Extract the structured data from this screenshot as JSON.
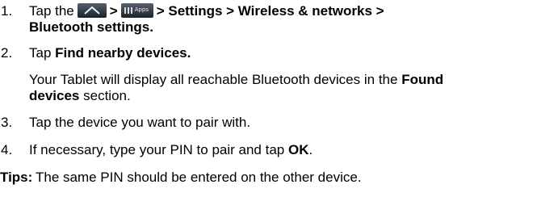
{
  "steps": [
    {
      "number": "1.",
      "text_tap": "Tap the",
      "sep1": ">",
      "path": "> Settings > Wireless & networks >",
      "path2": "Bluetooth settings."
    },
    {
      "number": "2.",
      "pre": "Tap",
      "bold": "Find nearby devices.",
      "note_pre": "Your Tablet will display all reachable Bluetooth devices in the",
      "note_bold1": "Found",
      "note_bold2": "devices",
      "note_post": "section."
    },
    {
      "number": "3.",
      "text": "Tap the device you want to pair with."
    },
    {
      "number": "4.",
      "pre": "If necessary, type your PIN to pair and tap",
      "bold": "OK",
      "post": "."
    }
  ],
  "tips": {
    "label": "Tips:",
    "text": "The same PIN should be entered on the other device."
  },
  "icons": {
    "home": "home-icon",
    "apps": "apps-icon",
    "apps_label": "Apps"
  }
}
